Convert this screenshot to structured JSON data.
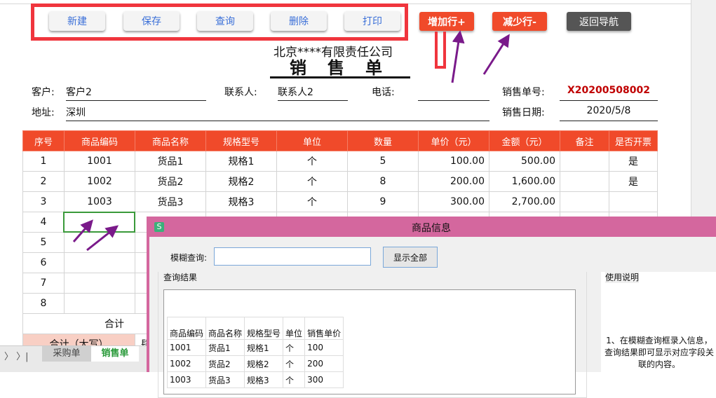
{
  "toolbar": {
    "new": "新建",
    "save": "保存",
    "query": "查询",
    "delete": "删除",
    "print": "打印",
    "add_row": "增加行+",
    "remove_row": "减少行-",
    "back": "返回导航"
  },
  "colors": {
    "accent": "#f04a2a",
    "highlight": "#f0353d",
    "dialog_title": "#d4679e",
    "order_no": "#c00000"
  },
  "header": {
    "company": "北京****有限责任公司",
    "title": "销售单"
  },
  "form": {
    "customer_label": "客户:",
    "customer": "客户2",
    "contact_label": "联系人:",
    "contact": "联系人2",
    "phone_label": "电话:",
    "phone": "",
    "order_no_label": "销售单号:",
    "order_no": "X20200508002",
    "address_label": "地址:",
    "address": "深圳",
    "date_label": "销售日期:",
    "date": "2020/5/8"
  },
  "table": {
    "headers": [
      "序号",
      "商品编码",
      "商品名称",
      "规格型号",
      "单位",
      "数量",
      "单价（元）",
      "金额（元）",
      "备注",
      "是否开票"
    ],
    "rows": [
      [
        "1",
        "1001",
        "货品1",
        "规格1",
        "个",
        "5",
        "100.00",
        "500.00",
        "",
        "是"
      ],
      [
        "2",
        "1002",
        "货品2",
        "规格2",
        "个",
        "8",
        "200.00",
        "1,600.00",
        "",
        "是"
      ],
      [
        "3",
        "1003",
        "货品3",
        "规格3",
        "个",
        "9",
        "300.00",
        "2,700.00",
        "",
        ""
      ],
      [
        "4",
        "",
        "",
        "",
        "",
        "",
        "",
        "",
        "",
        ""
      ],
      [
        "5",
        "",
        "",
        "",
        "",
        "",
        "",
        "",
        "",
        ""
      ],
      [
        "6",
        "",
        "",
        "",
        "",
        "",
        "",
        "",
        "",
        ""
      ],
      [
        "7",
        "",
        "",
        "",
        "",
        "",
        "",
        "",
        "",
        ""
      ],
      [
        "8",
        "",
        "",
        "",
        "",
        "",
        "",
        "",
        "",
        ""
      ]
    ],
    "total_label": "合计",
    "total_upper_label": "合计（大写）",
    "total_upper_value": "肆"
  },
  "sheet_tabs": [
    "采购单",
    "销售单"
  ],
  "dialog": {
    "icon": "S",
    "title": "商品信息",
    "search_label": "模糊查询:",
    "search_value": "",
    "show_all": "显示全部",
    "results_label": "查询结果",
    "help_label": "使用说明",
    "help_text": "1、在模糊查询框录入信息，查询结果即可显示对应字段关联的内容。",
    "columns": [
      "商品编码",
      "商品名称",
      "规格型号",
      "单位",
      "销售单价"
    ],
    "rows": [
      [
        "1001",
        "货品1",
        "规格1",
        "个",
        "100"
      ],
      [
        "1002",
        "货品2",
        "规格2",
        "个",
        "200"
      ],
      [
        "1003",
        "货品3",
        "规格3",
        "个",
        "300"
      ]
    ]
  }
}
